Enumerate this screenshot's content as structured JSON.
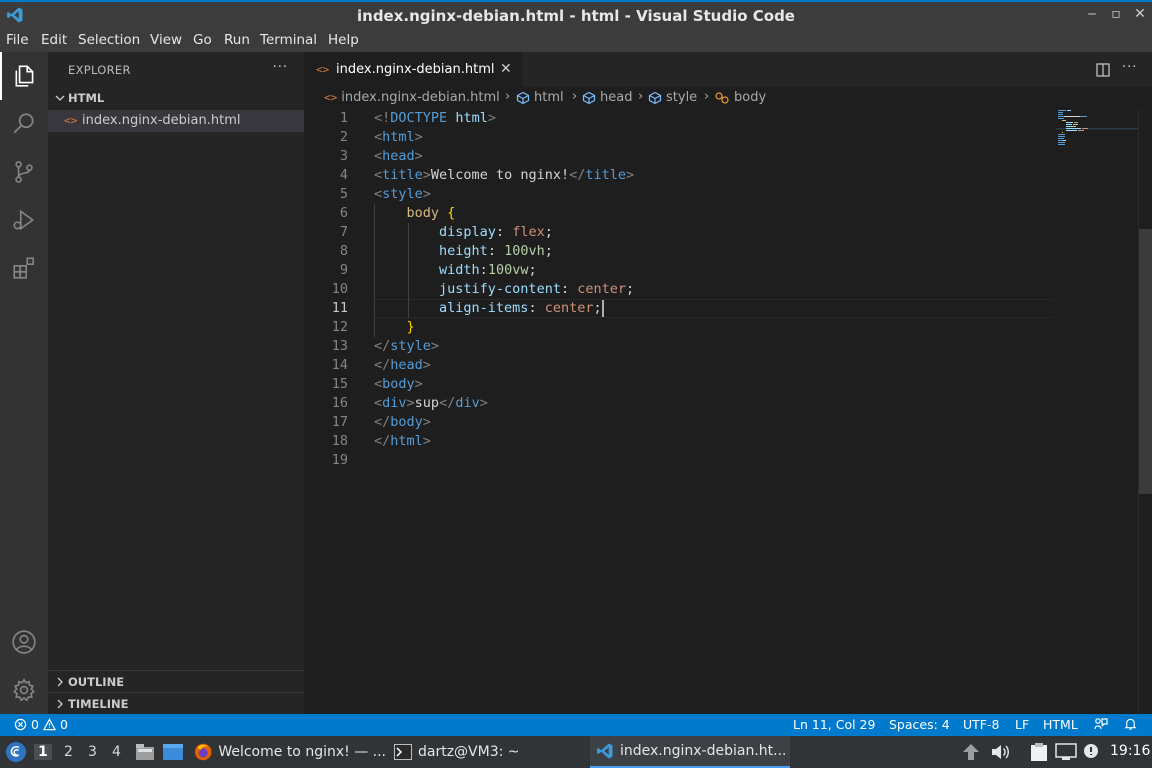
{
  "window": {
    "title": "index.nginx-debian.html - html - Visual Studio Code",
    "controls": [
      "‒",
      "▫",
      "✕"
    ]
  },
  "menu": [
    "File",
    "Edit",
    "Selection",
    "View",
    "Go",
    "Run",
    "Terminal",
    "Help"
  ],
  "activity_bar": {
    "items": [
      "files-icon",
      "search-icon",
      "source-control-icon",
      "run-debug-icon",
      "extensions-icon"
    ],
    "bottom": [
      "account-icon",
      "settings-gear-icon"
    ]
  },
  "sidebar": {
    "title": "EXPLORER",
    "more": "···",
    "folder": "HTML",
    "file_icon": "<>",
    "files": [
      "index.nginx-debian.html"
    ],
    "outline": "OUTLINE",
    "timeline": "TIMELINE"
  },
  "tab": {
    "icon": "<>",
    "label": "index.nginx-debian.html",
    "close": "✕",
    "more": "···"
  },
  "breadcrumb": [
    "index.nginx-debian.html",
    "html",
    "head",
    "style",
    "body"
  ],
  "editor": {
    "current_line": 11,
    "line_numbers": [
      "1",
      "2",
      "3",
      "4",
      "5",
      "6",
      "7",
      "8",
      "9",
      "10",
      "11",
      "12",
      "13",
      "14",
      "15",
      "16",
      "17",
      "18",
      "19"
    ],
    "lines": [
      [
        [
          "punc",
          "<!"
        ],
        [
          "tag",
          "DOCTYPE"
        ],
        [
          "text",
          " "
        ],
        [
          "prop",
          "html"
        ],
        [
          "punc",
          ">"
        ]
      ],
      [
        [
          "punc",
          "<"
        ],
        [
          "tag",
          "html"
        ],
        [
          "punc",
          ">"
        ]
      ],
      [
        [
          "punc",
          "<"
        ],
        [
          "tag",
          "head"
        ],
        [
          "punc",
          ">"
        ]
      ],
      [
        [
          "punc",
          "<"
        ],
        [
          "tag",
          "title"
        ],
        [
          "punc",
          ">"
        ],
        [
          "text",
          "Welcome to nginx!"
        ],
        [
          "punc",
          "</"
        ],
        [
          "tag",
          "title"
        ],
        [
          "punc",
          ">"
        ]
      ],
      [
        [
          "punc",
          "<"
        ],
        [
          "tag",
          "style"
        ],
        [
          "punc",
          ">"
        ]
      ],
      [
        [
          "text",
          "    "
        ],
        [
          "sel",
          "body"
        ],
        [
          "text",
          " "
        ],
        [
          "brace",
          "{"
        ]
      ],
      [
        [
          "text",
          "        "
        ],
        [
          "prop",
          "display"
        ],
        [
          "text",
          ": "
        ],
        [
          "val",
          "flex"
        ],
        [
          "text",
          ";"
        ]
      ],
      [
        [
          "text",
          "        "
        ],
        [
          "prop",
          "height"
        ],
        [
          "text",
          ": "
        ],
        [
          "num",
          "100vh"
        ],
        [
          "text",
          ";"
        ]
      ],
      [
        [
          "text",
          "        "
        ],
        [
          "prop",
          "width"
        ],
        [
          "text",
          ":"
        ],
        [
          "num",
          "100vw"
        ],
        [
          "text",
          ";"
        ]
      ],
      [
        [
          "text",
          "        "
        ],
        [
          "prop",
          "justify-content"
        ],
        [
          "text",
          ": "
        ],
        [
          "val",
          "center"
        ],
        [
          "text",
          ";"
        ]
      ],
      [
        [
          "text",
          "        "
        ],
        [
          "prop",
          "align-items"
        ],
        [
          "text",
          ": "
        ],
        [
          "val",
          "center"
        ],
        [
          "text",
          ";"
        ]
      ],
      [
        [
          "text",
          "    "
        ],
        [
          "brace",
          "}"
        ]
      ],
      [
        [
          "punc",
          "</"
        ],
        [
          "tag",
          "style"
        ],
        [
          "punc",
          ">"
        ]
      ],
      [
        [
          "punc",
          "</"
        ],
        [
          "tag",
          "head"
        ],
        [
          "punc",
          ">"
        ]
      ],
      [
        [
          "punc",
          "<"
        ],
        [
          "tag",
          "body"
        ],
        [
          "punc",
          ">"
        ]
      ],
      [
        [
          "punc",
          "<"
        ],
        [
          "tag",
          "div"
        ],
        [
          "punc",
          ">"
        ],
        [
          "text",
          "sup"
        ],
        [
          "punc",
          "</"
        ],
        [
          "tag",
          "div"
        ],
        [
          "punc",
          ">"
        ]
      ],
      [
        [
          "punc",
          "</"
        ],
        [
          "tag",
          "body"
        ],
        [
          "punc",
          ">"
        ]
      ],
      [
        [
          "punc",
          "</"
        ],
        [
          "tag",
          "html"
        ],
        [
          "punc",
          ">"
        ]
      ],
      []
    ]
  },
  "status": {
    "errors": "0",
    "warnings": "0",
    "position": "Ln 11, Col 29",
    "spaces": "Spaces: 4",
    "encoding": "UTF-8",
    "eol": "LF",
    "language": "HTML"
  },
  "taskbar": {
    "workspaces": [
      "1",
      "2",
      "3",
      "4"
    ],
    "tasks": [
      "Welcome to nginx! — ...",
      "dartz@VM3: ~",
      "index.nginx-debian.ht..."
    ],
    "clock": "19:16"
  },
  "colors": {
    "accent": "#007acc",
    "tag": "#569cd6",
    "property": "#9cdcfe",
    "string_value": "#ce9178",
    "number": "#b5cea8",
    "selector": "#d7ba7d",
    "html_file_icon": "#e37933"
  }
}
